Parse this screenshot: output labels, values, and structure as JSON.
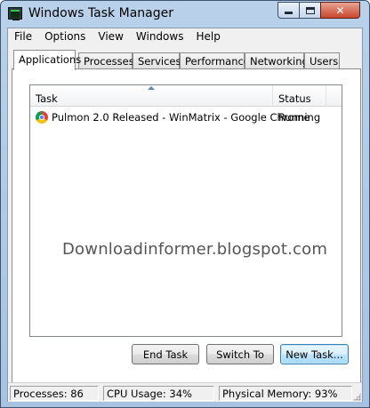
{
  "window": {
    "title": "Windows Task Manager",
    "controls": {
      "minimize_icon": "minimize-icon",
      "maximize_icon": "maximize-icon",
      "close_label": "✕"
    }
  },
  "menu": [
    "File",
    "Options",
    "View",
    "Windows",
    "Help"
  ],
  "tabs": [
    {
      "label": "Applications",
      "active": true
    },
    {
      "label": "Processes",
      "active": false
    },
    {
      "label": "Services",
      "active": false
    },
    {
      "label": "Performance",
      "active": false
    },
    {
      "label": "Networking",
      "active": false
    },
    {
      "label": "Users",
      "active": false
    }
  ],
  "task_list": {
    "columns": {
      "task": "Task",
      "status": "Status"
    },
    "sorted_column": "task",
    "rows": [
      {
        "icon": "chrome-icon",
        "task": "Pulmon 2.0 Released - WinMatrix - Google Chrome",
        "status": "Running"
      }
    ]
  },
  "watermark": "Downloadinformer.blogspot.com",
  "buttons": {
    "end_task": "End Task",
    "switch_to": "Switch To",
    "new_task": "New Task..."
  },
  "status_bar": {
    "processes": "Processes: 86",
    "cpu": "CPU Usage: 34%",
    "memory": "Physical Memory: 93%"
  },
  "colors": {
    "title_bar": "#b9d1ea",
    "close_button": "#c9462c",
    "default_button": "#bee6fd",
    "sort_arrow": "#5a88b5"
  }
}
